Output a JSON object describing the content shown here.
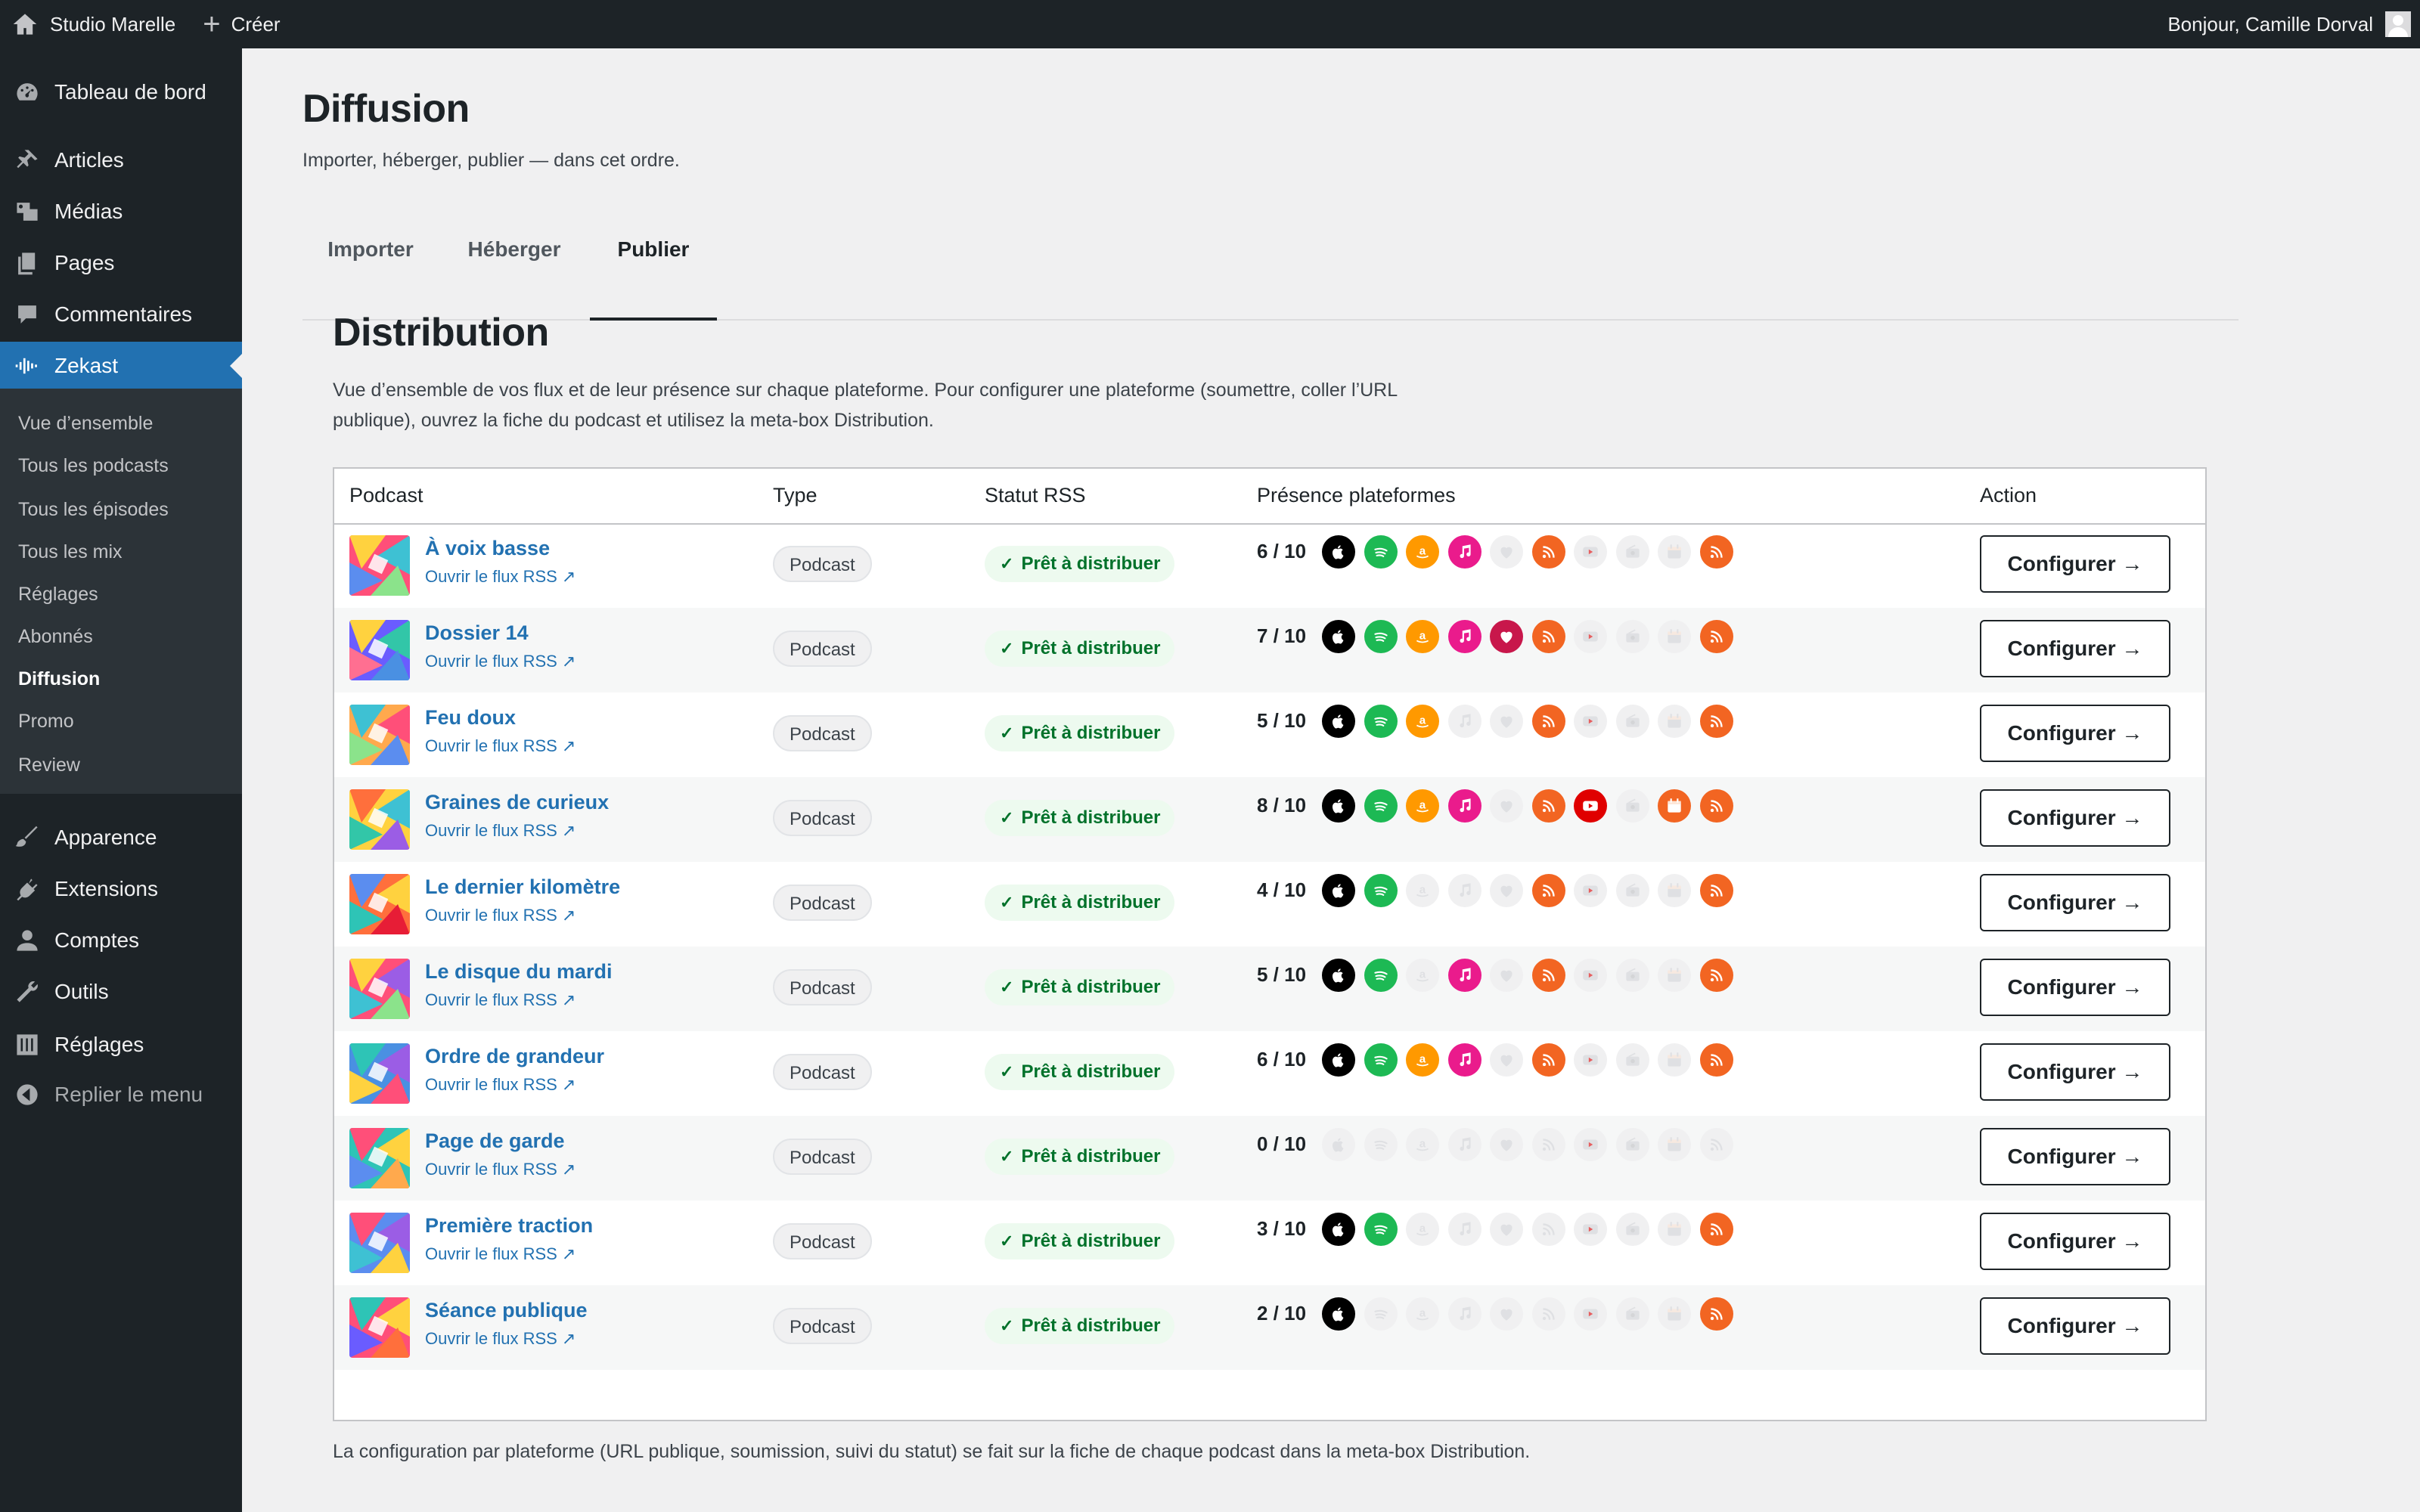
{
  "adminbar": {
    "site_name": "Studio Marelle",
    "new_label": "Créer",
    "howdy": "Bonjour, Camille Dorval"
  },
  "sidebar": {
    "dashboard": "Tableau de bord",
    "articles": "Articles",
    "medias": "Médias",
    "pages": "Pages",
    "comments": "Commentaires",
    "zekast": "Zekast",
    "submenu": [
      "Vue d’ensemble",
      "Tous les podcasts",
      "Tous les épisodes",
      "Tous les mix",
      "Réglages",
      "Abonnés",
      "Diffusion",
      "Promo",
      "Review"
    ],
    "appearance": "Apparence",
    "extensions": "Extensions",
    "accounts": "Comptes",
    "tools": "Outils",
    "settings": "Réglages",
    "collapse": "Replier le menu"
  },
  "page": {
    "title": "Diffusion",
    "subtitle": "Importer, héberger, publier — dans cet ordre.",
    "tabs": [
      "Importer",
      "Héberger",
      "Publier"
    ],
    "active_tab": "Publier"
  },
  "section": {
    "title": "Distribution",
    "description": "Vue d’ensemble de vos flux et de leur présence sur chaque plateforme. Pour configurer une plateforme (soumettre, coller l’URL publique), ouvrez la fiche du podcast et utilisez la meta-box Distribution."
  },
  "table": {
    "headers": [
      "Podcast",
      "Type",
      "Statut RSS",
      "Présence plateformes",
      "Action"
    ],
    "feed_link_label": "Ouvrir le flux RSS ↗",
    "type_label": "Podcast",
    "status_label": "Prêt à distribuer",
    "action_label": "Configurer →",
    "platforms": [
      {
        "icon": "apple-podcasts-icon",
        "color": "#000000"
      },
      {
        "icon": "spotify-icon",
        "color": "#1db954"
      },
      {
        "icon": "amazon-music-icon",
        "color": "#ff9900"
      },
      {
        "icon": "music-note-icon",
        "color": "#ea1b8c"
      },
      {
        "icon": "heart-icon",
        "color": "#c8174b"
      },
      {
        "icon": "rss-icon",
        "color": "#f26522"
      },
      {
        "icon": "youtube-icon",
        "color": "#e00000"
      },
      {
        "icon": "radio-icon",
        "color": "#9aa0a6"
      },
      {
        "icon": "calendar-icon",
        "color": "#f26522"
      },
      {
        "icon": "rss-feed-icon",
        "color": "#f26522"
      }
    ],
    "rows": [
      {
        "name": "À voix basse",
        "count": "6 / 10",
        "presence": [
          1,
          1,
          1,
          1,
          0,
          1,
          0,
          0,
          0,
          1
        ]
      },
      {
        "name": "Dossier 14",
        "count": "7 / 10",
        "presence": [
          1,
          1,
          1,
          1,
          1,
          1,
          0,
          0,
          0,
          1
        ]
      },
      {
        "name": "Feu doux",
        "count": "5 / 10",
        "presence": [
          1,
          1,
          1,
          0,
          0,
          1,
          0,
          0,
          0,
          1
        ]
      },
      {
        "name": "Graines de curieux",
        "count": "8 / 10",
        "presence": [
          1,
          1,
          1,
          1,
          0,
          1,
          1,
          0,
          1,
          1
        ]
      },
      {
        "name": "Le dernier kilomètre",
        "count": "4 / 10",
        "presence": [
          1,
          1,
          0,
          0,
          0,
          1,
          0,
          0,
          0,
          1
        ]
      },
      {
        "name": "Le disque du mardi",
        "count": "5 / 10",
        "presence": [
          1,
          1,
          0,
          1,
          0,
          1,
          0,
          0,
          0,
          1
        ]
      },
      {
        "name": "Ordre de grandeur",
        "count": "6 / 10",
        "presence": [
          1,
          1,
          1,
          1,
          0,
          1,
          0,
          0,
          0,
          1
        ]
      },
      {
        "name": "Page de garde",
        "count": "0 / 10",
        "presence": [
          0,
          0,
          0,
          0,
          0,
          0,
          0,
          0,
          0,
          0
        ]
      },
      {
        "name": "Première traction",
        "count": "3 / 10",
        "presence": [
          1,
          1,
          0,
          0,
          0,
          0,
          0,
          0,
          0,
          1
        ]
      },
      {
        "name": "Séance publique",
        "count": "2 / 10",
        "presence": [
          1,
          0,
          0,
          0,
          0,
          0,
          0,
          0,
          0,
          1
        ]
      }
    ]
  },
  "footnote": "La configuration par plateforme (URL publique, soumission, suivi du statut) se fait sur la fiche de chaque podcast dans la meta-box Distribution."
}
